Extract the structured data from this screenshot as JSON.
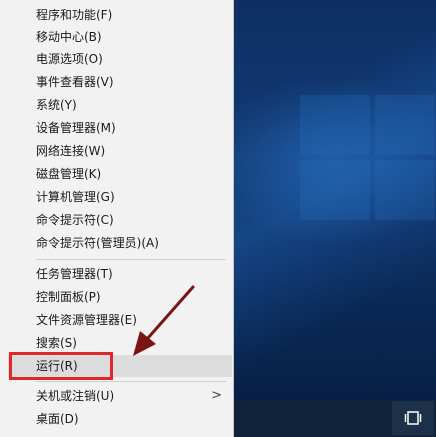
{
  "menu": {
    "groups": [
      {
        "items": [
          {
            "label": "程序和功能(F)"
          },
          {
            "label": "移动中心(B)"
          },
          {
            "label": "电源选项(O)"
          },
          {
            "label": "事件查看器(V)"
          },
          {
            "label": "系统(Y)"
          },
          {
            "label": "设备管理器(M)"
          },
          {
            "label": "网络连接(W)"
          },
          {
            "label": "磁盘管理(K)"
          },
          {
            "label": "计算机管理(G)"
          },
          {
            "label": "命令提示符(C)"
          },
          {
            "label": "命令提示符(管理员)(A)"
          }
        ]
      },
      {
        "items": [
          {
            "label": "任务管理器(T)"
          },
          {
            "label": "控制面板(P)"
          },
          {
            "label": "文件资源管理器(E)"
          },
          {
            "label": "搜索(S)"
          },
          {
            "label": "运行(R)",
            "selected": true
          }
        ]
      },
      {
        "items": [
          {
            "label": "关机或注销(U)",
            "submenu": true
          },
          {
            "label": "桌面(D)"
          }
        ]
      }
    ],
    "submenu_glyph": ">"
  },
  "annotation": {
    "highlight_color": "#e1262b",
    "arrow_color": "#7a1414"
  },
  "taskbar": {
    "task_view_icon": "task-view-icon",
    "task_view_glyph": "▯"
  }
}
